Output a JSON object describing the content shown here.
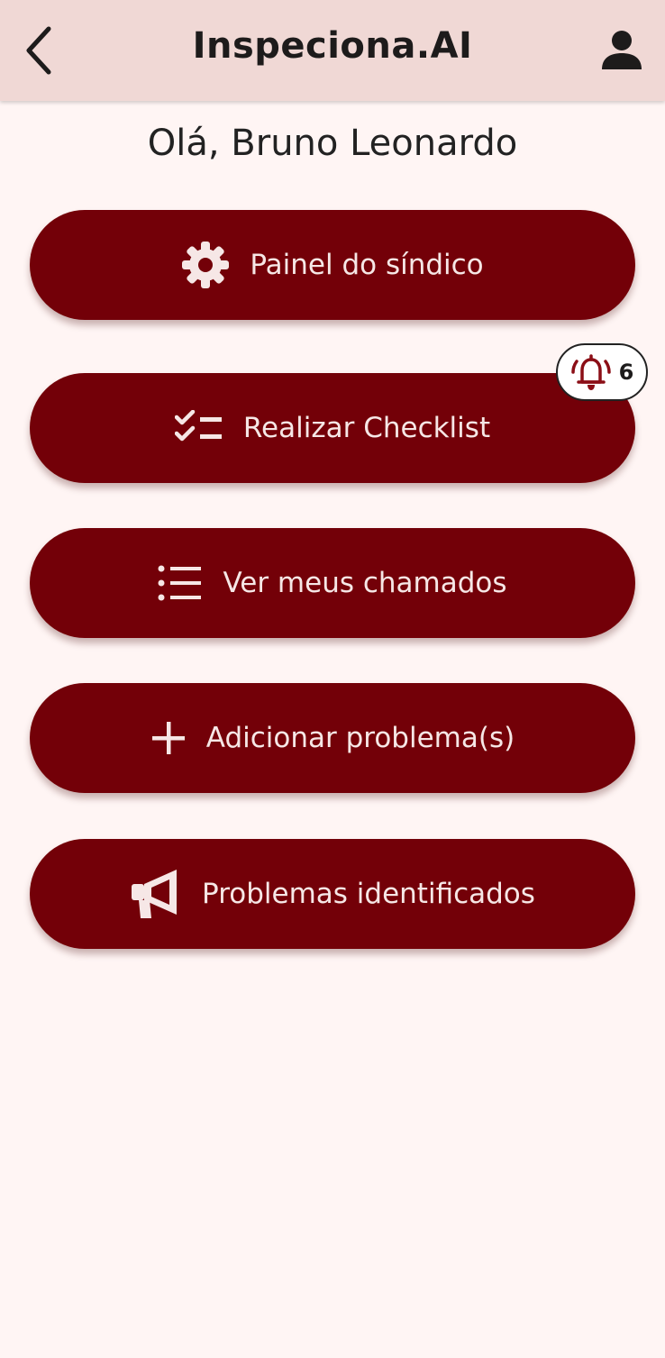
{
  "app_bar": {
    "title": "Inspeciona.AI",
    "back_icon": "chevron-left-icon",
    "profile_icon": "person-icon"
  },
  "greeting": "Olá, Bruno Leonardo",
  "menu": {
    "items": [
      {
        "label": "Painel do síndico",
        "icon": "gear-icon"
      },
      {
        "label": "Realizar Checklist",
        "icon": "checklist-icon"
      },
      {
        "label": "Ver meus chamados",
        "icon": "list-icon"
      },
      {
        "label": "Adicionar problema(s)",
        "icon": "plus-icon"
      },
      {
        "label": "Problemas identificados",
        "icon": "megaphone-icon"
      }
    ]
  },
  "notification_badge": {
    "icon": "bell-ringing-icon",
    "count": "6"
  },
  "colors": {
    "app_bar_bg": "#f0d8d5",
    "page_bg": "#fff5f4",
    "button_bg": "#730008",
    "button_text": "#f6e7e6",
    "bell": "#8b0e16"
  }
}
